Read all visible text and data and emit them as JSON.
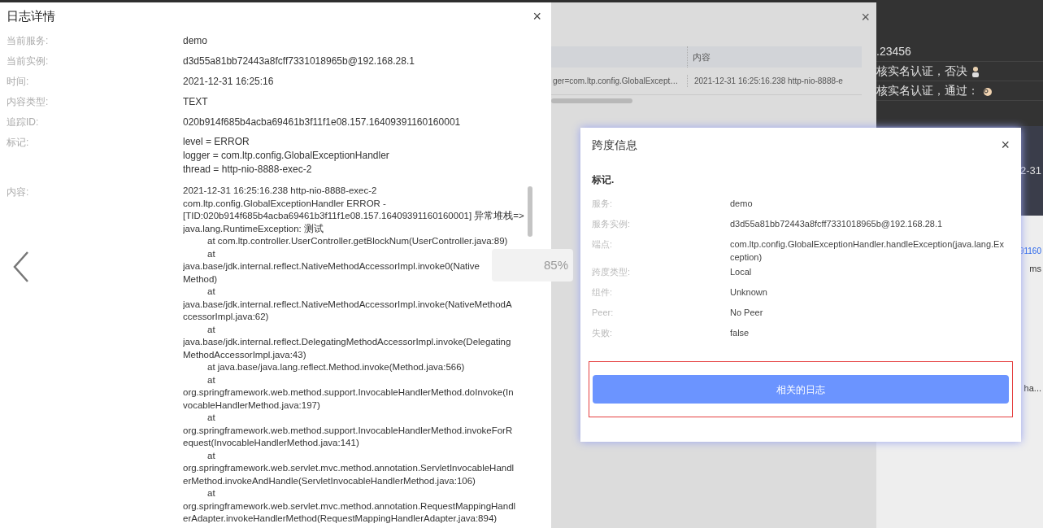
{
  "log_detail": {
    "title": "日志详情",
    "close": "×",
    "fields": [
      {
        "label": "当前服务:",
        "value": "demo"
      },
      {
        "label": "当前实例:",
        "value": "d3d55a81bb72443a8fcff7331018965b@192.168.28.1"
      },
      {
        "label": "时间:",
        "value": "2021-12-31 16:25:16"
      },
      {
        "label": "内容类型:",
        "value": "TEXT"
      },
      {
        "label": "追踪ID:",
        "value": "020b914f685b4acba69461b3f11f1e08.157.16409391160160001"
      }
    ],
    "tags": {
      "label": "标记:",
      "lines": [
        "level = ERROR",
        "logger = com.ltp.config.GlobalExceptionHandler",
        "thread = http-nio-8888-exec-2"
      ]
    },
    "content": {
      "label": "内容:",
      "lines": [
        {
          "text": "2021-12-31 16:25:16.238  http-nio-8888-exec-2",
          "indent": false
        },
        {
          "text": "com.ltp.config.GlobalExceptionHandler ERROR -",
          "indent": false
        },
        {
          "text": "[TID:020b914f685b4acba69461b3f11f1e08.157.16409391160160001] 异常堆栈=>",
          "indent": false
        },
        {
          "text": "java.lang.RuntimeException: 测试",
          "indent": false
        },
        {
          "text": "at com.ltp.controller.UserController.getBlockNum(UserController.java:89)",
          "indent": true
        },
        {
          "text": "at",
          "indent": true
        },
        {
          "text": "java.base/jdk.internal.reflect.NativeMethodAccessorImpl.invoke0(Native",
          "indent": false
        },
        {
          "text": "Method)",
          "indent": false
        },
        {
          "text": "at",
          "indent": true
        },
        {
          "text": "java.base/jdk.internal.reflect.NativeMethodAccessorImpl.invoke(NativeMethodA",
          "indent": false
        },
        {
          "text": "ccessorImpl.java:62)",
          "indent": false
        },
        {
          "text": "at",
          "indent": true
        },
        {
          "text": "java.base/jdk.internal.reflect.DelegatingMethodAccessorImpl.invoke(Delegating",
          "indent": false
        },
        {
          "text": "MethodAccessorImpl.java:43)",
          "indent": false
        },
        {
          "text": "at java.base/java.lang.reflect.Method.invoke(Method.java:566)",
          "indent": true
        },
        {
          "text": "at",
          "indent": true
        },
        {
          "text": "org.springframework.web.method.support.InvocableHandlerMethod.doInvoke(In",
          "indent": false
        },
        {
          "text": "vocableHandlerMethod.java:197)",
          "indent": false
        },
        {
          "text": "at",
          "indent": true
        },
        {
          "text": "org.springframework.web.method.support.InvocableHandlerMethod.invokeForR",
          "indent": false
        },
        {
          "text": "equest(InvocableHandlerMethod.java:141)",
          "indent": false
        },
        {
          "text": "at",
          "indent": true
        },
        {
          "text": "org.springframework.web.servlet.mvc.method.annotation.ServletInvocableHandl",
          "indent": false
        },
        {
          "text": "erMethod.invokeAndHandle(ServletInvocableHandlerMethod.java:106)",
          "indent": false
        },
        {
          "text": "at",
          "indent": true
        },
        {
          "text": "org.springframework.web.servlet.mvc.method.annotation.RequestMappingHandl",
          "indent": false
        },
        {
          "text": "erAdapter.invokeHandlerMethod(RequestMappingHandlerAdapter.java:894)",
          "indent": false
        }
      ]
    }
  },
  "zoom_indicator": "85%",
  "background_dialog": {
    "close": "×",
    "table": {
      "columns": [
        "",
        "内容"
      ],
      "rows": [
        [
          "ger=com.ltp.config.GlobalExcept…",
          "2021-12-31 16:25:16.238 http-nio-8888-e"
        ]
      ]
    }
  },
  "span_dialog": {
    "title": "跨度信息",
    "close": "×",
    "section": "标记.",
    "fields": [
      {
        "label": "服务:",
        "value": "demo"
      },
      {
        "label": "服务实例:",
        "value": "d3d55a81bb72443a8fcff7331018965b@192.168.28.1"
      },
      {
        "label": "端点:",
        "value": "com.ltp.config.GlobalExceptionHandler.handleException(java.lang.Exception)"
      },
      {
        "label": "跨度类型:",
        "value": "Local"
      },
      {
        "label": "组件:",
        "value": "Unknown"
      },
      {
        "label": "Peer:",
        "value": "No Peer"
      },
      {
        "label": "失败:",
        "value": "false"
      }
    ],
    "button": "相关的日志"
  },
  "background_page": {
    "lines": [
      ".23456",
      "核实名认证，否决",
      "核实名认证，通过："
    ],
    "date": "2-31",
    "link": "91160",
    "duration": "ms",
    "truncated": "ha..."
  }
}
